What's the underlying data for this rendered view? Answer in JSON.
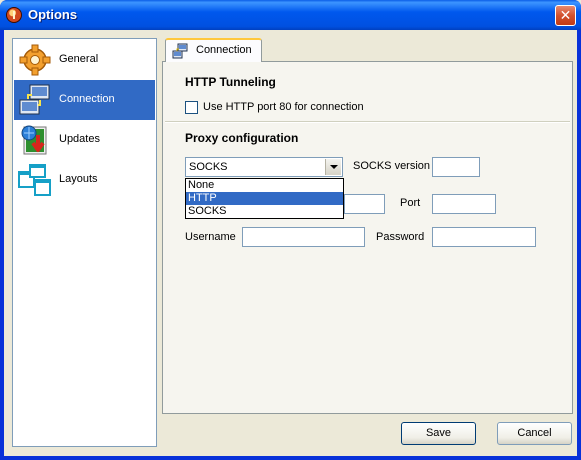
{
  "window": {
    "title": "Options",
    "close_glyph": "✕"
  },
  "sidebar": {
    "items": [
      {
        "label": "General",
        "icon": "gear-icon"
      },
      {
        "label": "Connection",
        "icon": "network-connection-icon",
        "selected": true
      },
      {
        "label": "Updates",
        "icon": "update-download-icon"
      },
      {
        "label": "Layouts",
        "icon": "windows-layout-icon"
      }
    ]
  },
  "tab": {
    "label": "Connection"
  },
  "http_tunneling": {
    "title": "HTTP Tunneling",
    "checkbox_label": "Use HTTP port 80 for connection",
    "checked": false
  },
  "proxy": {
    "title": "Proxy configuration",
    "type_value": "SOCKS",
    "type_options": [
      "None",
      "HTTP",
      "SOCKS"
    ],
    "highlighted_option": "HTTP",
    "socks_version_label": "SOCKS version",
    "socks_version_value": "",
    "host_value": "",
    "port_label": "Port",
    "port_value": "",
    "username_label": "Username",
    "username_value": "",
    "password_label": "Password",
    "password_value": ""
  },
  "buttons": {
    "save": "Save",
    "cancel": "Cancel"
  },
  "colors": {
    "title_bar": "#0058ee",
    "selection": "#316ac5",
    "dialog_bg": "#ece9d8",
    "tab_accent": "#ffc83c"
  }
}
